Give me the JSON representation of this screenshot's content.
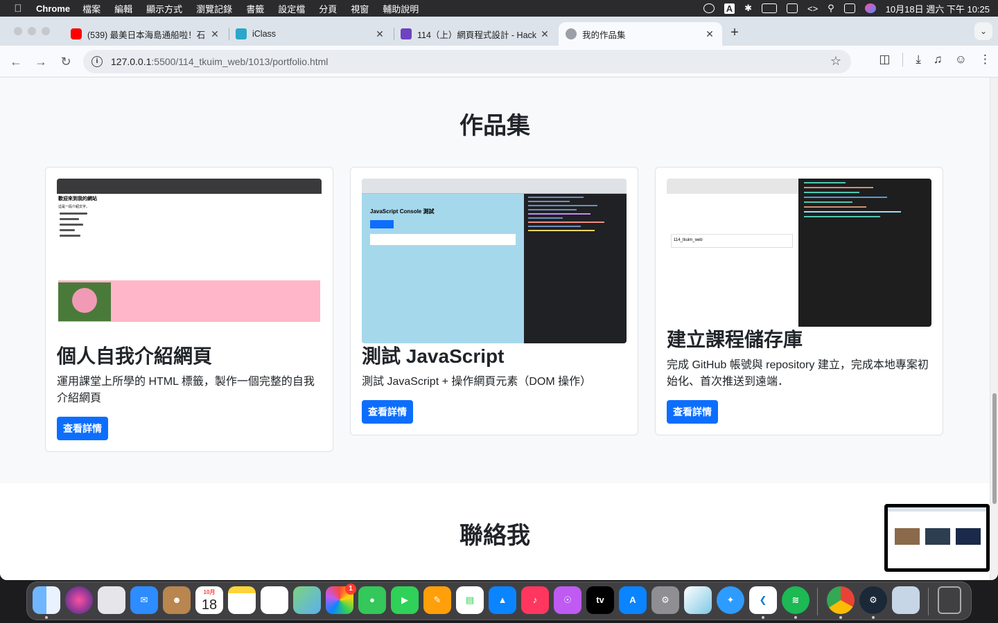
{
  "menubar": {
    "app": "Chrome",
    "items": [
      "檔案",
      "編輯",
      "顯示方式",
      "瀏覽記錄",
      "書籤",
      "設定檔",
      "分頁",
      "視窗",
      "輔助說明"
    ],
    "clock": "10月18日 週六 下午 10:25",
    "input_indicator": "A"
  },
  "tabs": [
    {
      "title": "(539) 最美日本海島通船啦！石",
      "favicon": "youtube-icon",
      "favicon_color": "#ff0000"
    },
    {
      "title": "iClass",
      "favicon": "iclass-icon",
      "favicon_color": "#2aa7c9"
    },
    {
      "title": "114（上）網頁程式設計 - Hack",
      "favicon": "hackmd-icon",
      "favicon_color": "#6f42c1"
    },
    {
      "title": "我的作品集",
      "favicon": "globe-icon",
      "favicon_color": "#9aa0a6",
      "active": true
    }
  ],
  "address": {
    "host": "127.0.0.1",
    "path": ":5500/114_tkuim_web/1013/portfolio.html"
  },
  "page": {
    "portfolio_title": "作品集",
    "contact_title": "聯絡我",
    "cards": [
      {
        "title": "個人自我介紹網頁",
        "description": "運用課堂上所學的 HTML 標籤，製作一個完整的自我介紹網頁",
        "button": "查看詳情"
      },
      {
        "title": "測試 JavaScript",
        "description": "測試 JavaScript + 操作網頁元素（DOM 操作）",
        "button": "查看詳情"
      },
      {
        "title": "建立課程儲存庫",
        "description": "完成 GitHub 帳號與 repository 建立，完成本地專案初始化、首次推送到遠端．",
        "button": "查看詳情"
      }
    ],
    "thumb1": {
      "heading": "歡迎來到我的網站",
      "sub": "這是一段介紹文字。"
    },
    "thumb2": {
      "heading": "JavaScript Console 測試"
    },
    "thumb3": {
      "repo": "114_tkuim_web"
    }
  },
  "dock": {
    "calendar_month": "10月",
    "calendar_day": "18",
    "photos_badge": "1",
    "apps": [
      "finder-icon",
      "siri-icon",
      "launchpad-icon",
      "mail-icon",
      "contacts-icon",
      "calendar-icon",
      "notes-icon",
      "reminders-icon",
      "maps-icon",
      "photos-icon",
      "messages-icon",
      "facetime-icon",
      "pages-icon",
      "numbers-icon",
      "keynote-icon",
      "music-icon",
      "podcasts-icon",
      "appletv-icon",
      "appstore-icon",
      "settings-icon",
      "cube-icon",
      "safari-icon",
      "vscode-icon",
      "spotify-icon",
      "chrome-icon",
      "steam-icon",
      "preview-icon",
      "trash-icon"
    ],
    "appletv_label": "tv"
  },
  "colors": {
    "accent": "#0d6efd",
    "page_bg": "#f8f9fa"
  }
}
